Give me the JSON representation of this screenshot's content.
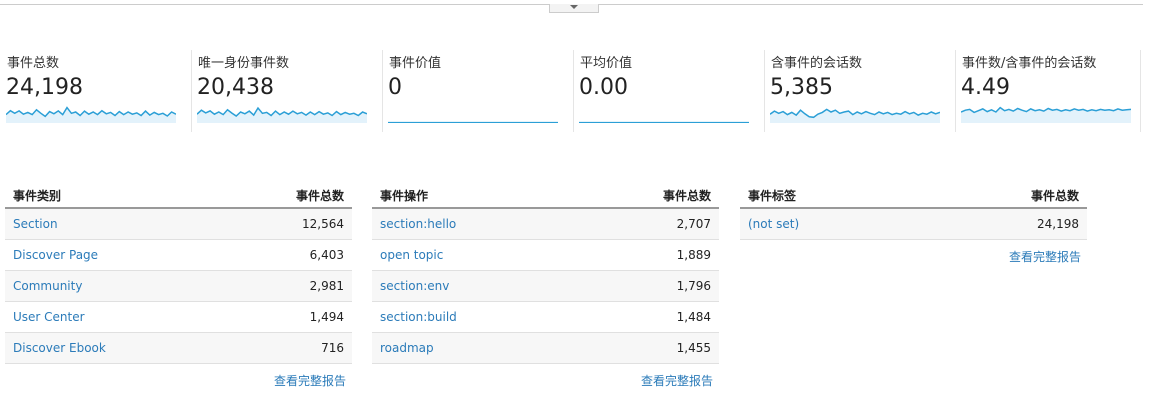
{
  "metrics": [
    {
      "label": "事件总数",
      "value": "24,198",
      "spark": [
        0.62,
        0.44,
        0.56,
        0.45,
        0.6,
        0.52,
        0.62,
        0.4,
        0.56,
        0.7,
        0.48,
        0.58,
        0.45,
        0.62,
        0.3,
        0.56,
        0.5,
        0.66,
        0.46,
        0.6,
        0.5,
        0.62,
        0.44,
        0.58,
        0.52,
        0.66,
        0.48,
        0.62,
        0.5,
        0.6,
        0.54,
        0.66,
        0.46,
        0.64,
        0.52,
        0.62,
        0.56,
        0.68,
        0.5,
        0.6
      ]
    },
    {
      "label": "唯一身份事件数",
      "value": "20,438",
      "spark": [
        0.6,
        0.42,
        0.54,
        0.45,
        0.6,
        0.5,
        0.62,
        0.4,
        0.55,
        0.68,
        0.5,
        0.58,
        0.46,
        0.64,
        0.32,
        0.56,
        0.52,
        0.66,
        0.46,
        0.62,
        0.5,
        0.6,
        0.46,
        0.58,
        0.52,
        0.64,
        0.5,
        0.62,
        0.48,
        0.6,
        0.54,
        0.66,
        0.48,
        0.62,
        0.52,
        0.6,
        0.56,
        0.66,
        0.5,
        0.58
      ]
    },
    {
      "label": "事件价值",
      "value": "0",
      "spark": [
        0.98,
        0.98,
        0.98,
        0.98,
        0.98,
        0.98,
        0.98,
        0.98,
        0.98,
        0.98
      ]
    },
    {
      "label": "平均价值",
      "value": "0.00",
      "spark": [
        0.98,
        0.98,
        0.98,
        0.98,
        0.98,
        0.98,
        0.98,
        0.98,
        0.98,
        0.98
      ]
    },
    {
      "label": "含事件的会话数",
      "value": "5,385",
      "spark": [
        0.6,
        0.46,
        0.56,
        0.48,
        0.62,
        0.52,
        0.64,
        0.42,
        0.58,
        0.72,
        0.74,
        0.6,
        0.52,
        0.38,
        0.5,
        0.42,
        0.56,
        0.5,
        0.46,
        0.62,
        0.5,
        0.58,
        0.48,
        0.56,
        0.62,
        0.5,
        0.58,
        0.52,
        0.62,
        0.56,
        0.6,
        0.48,
        0.58,
        0.52,
        0.64,
        0.56,
        0.6,
        0.5,
        0.58,
        0.52
      ]
    },
    {
      "label": "事件数/含事件的会话数",
      "value": "4.49",
      "spark": [
        0.5,
        0.42,
        0.38,
        0.52,
        0.44,
        0.36,
        0.48,
        0.4,
        0.5,
        0.3,
        0.44,
        0.38,
        0.46,
        0.34,
        0.42,
        0.48,
        0.36,
        0.44,
        0.4,
        0.46,
        0.34,
        0.42,
        0.38,
        0.46,
        0.4,
        0.44,
        0.36,
        0.42,
        0.38,
        0.46,
        0.4,
        0.44,
        0.38,
        0.42,
        0.4,
        0.44,
        0.36,
        0.42,
        0.4,
        0.38
      ]
    }
  ],
  "tables": [
    {
      "col1": "事件类别",
      "col2": "事件总数",
      "rows": [
        {
          "name": "Section",
          "count": "12,564"
        },
        {
          "name": "Discover Page",
          "count": "6,403"
        },
        {
          "name": "Community",
          "count": "2,981"
        },
        {
          "name": "User Center",
          "count": "1,494"
        },
        {
          "name": "Discover Ebook",
          "count": "716"
        }
      ],
      "link": "查看完整报告"
    },
    {
      "col1": "事件操作",
      "col2": "事件总数",
      "rows": [
        {
          "name": "section:hello",
          "count": "2,707"
        },
        {
          "name": "open topic",
          "count": "1,889"
        },
        {
          "name": "section:env",
          "count": "1,796"
        },
        {
          "name": "section:build",
          "count": "1,484"
        },
        {
          "name": "roadmap",
          "count": "1,455"
        }
      ],
      "link": "查看完整报告"
    },
    {
      "col1": "事件标签",
      "col2": "事件总数",
      "rows": [
        {
          "name": "(not set)",
          "count": "24,198"
        }
      ],
      "link": "查看完整报告"
    }
  ],
  "colors": {
    "accent": "#2b9fd6",
    "fill": "#e3f2fb",
    "link": "#2b7bb9"
  }
}
